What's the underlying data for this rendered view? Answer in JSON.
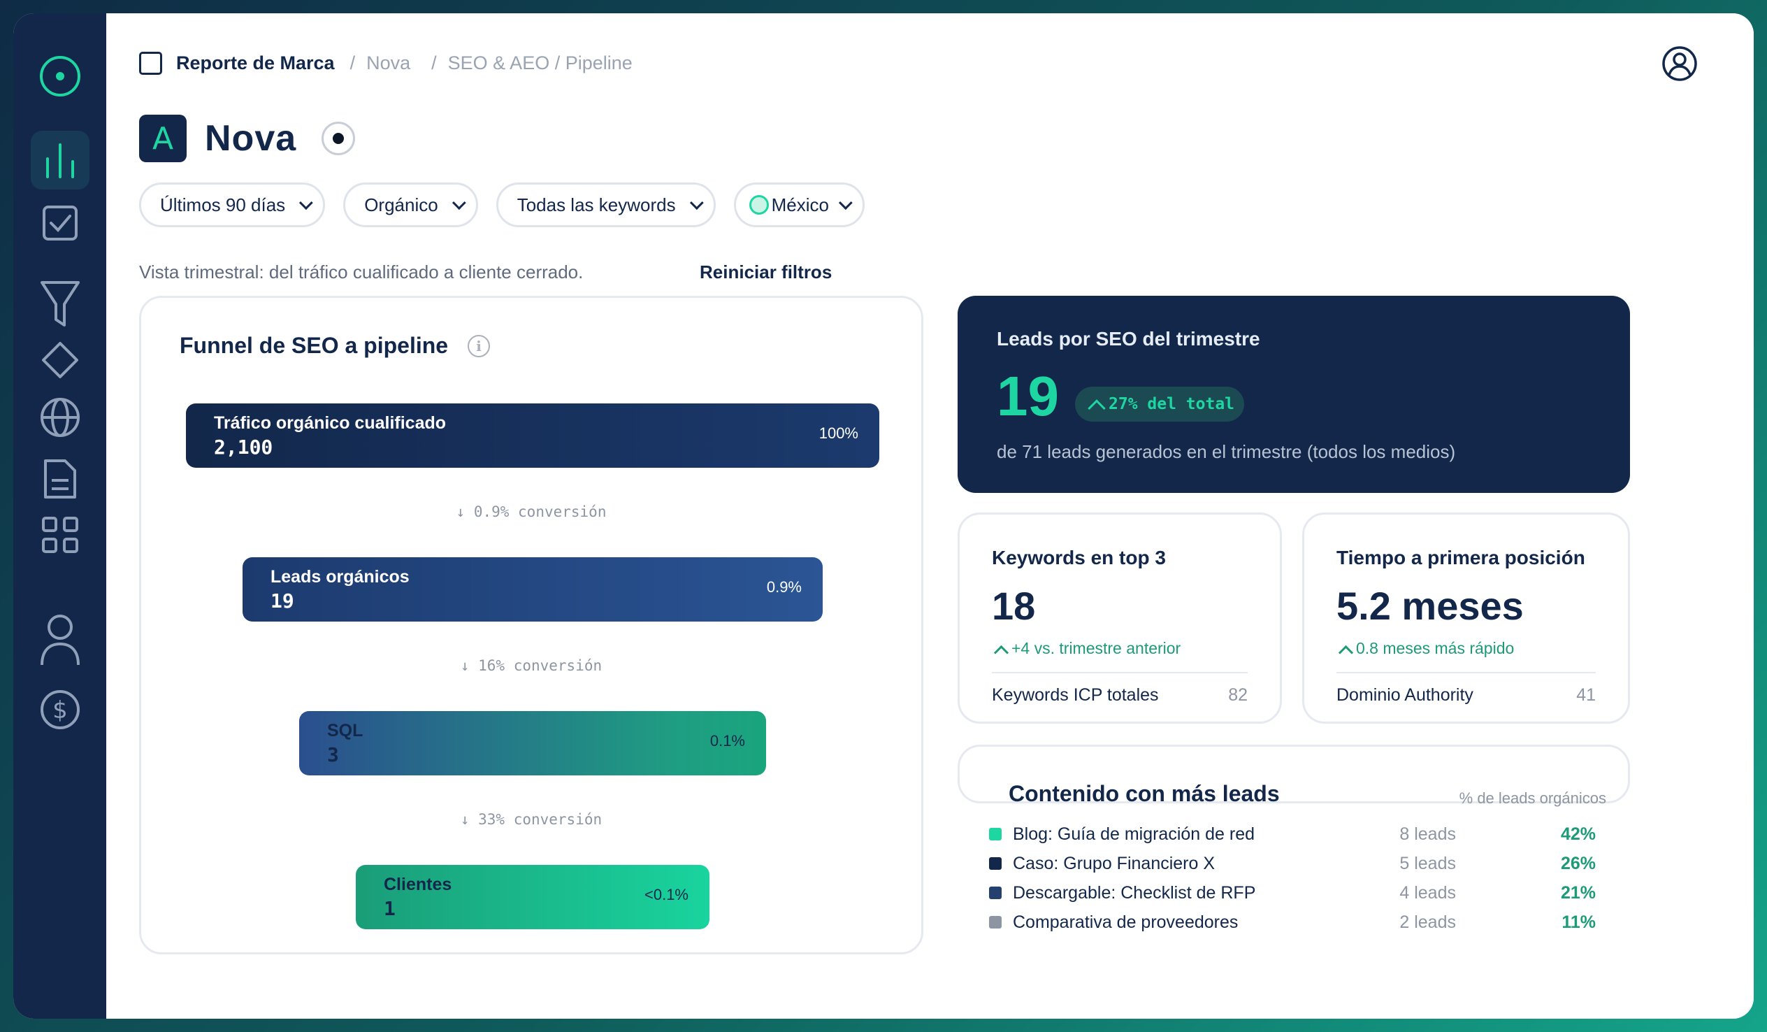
{
  "breadcrumb": {
    "root": "Reporte de Marca",
    "brand": "Nova",
    "section": "SEO & AEO / Pipeline"
  },
  "page": {
    "title": "Nova",
    "avatar_letter": "A"
  },
  "filters": [
    {
      "label": "Últimos 90 días"
    },
    {
      "label": "Orgánico"
    },
    {
      "label": "Todas las keywords"
    },
    {
      "label": "México"
    }
  ],
  "subtitle": "Vista trimestral: del tráfico cualificado a cliente cerrado.",
  "reset_label": "Reiniciar filtros",
  "funnel": {
    "title": "Funnel de SEO a pipeline",
    "stages": [
      {
        "label": "Tráfico orgánico cualificado",
        "value": "2,100",
        "pct": "100%"
      },
      {
        "label": "Leads orgánicos",
        "value": "19",
        "pct": "0.9%"
      },
      {
        "label": "SQL",
        "value": "3",
        "pct": "0.1%"
      },
      {
        "label": "Clientes",
        "value": "1",
        "pct": "<0.1%"
      }
    ],
    "conversions": [
      "↓ 0.9% conversión",
      "↓ 16% conversión",
      "↓ 33% conversión"
    ]
  },
  "leads_card": {
    "title": "Leads por SEO del trimestre",
    "value": "19",
    "badge": "27% del total",
    "sub": "de 71 leads generados en el trimestre (todos los medios)"
  },
  "kpis": [
    {
      "title": "Keywords en top 3",
      "value": "18",
      "delta": "+4 vs. trimestre anterior",
      "foot_label": "Keywords ICP totales",
      "foot_value": "82"
    },
    {
      "title": "Tiempo a primera posición",
      "value": "5.2 meses",
      "delta": "0.8 meses más rápido",
      "foot_label": "Dominio Authority",
      "foot_value": "41"
    }
  ],
  "content": {
    "title": "Contenido con más leads",
    "header": "% de leads orgánicos",
    "rows": [
      {
        "name": "Blog: Guía de migración de red",
        "leads": "8 leads",
        "pct": "42%",
        "color": "#1ed6a2"
      },
      {
        "name": "Caso: Grupo Financiero X",
        "leads": "5 leads",
        "pct": "26%",
        "color": "#12274a"
      },
      {
        "name": "Descargable: Checklist de RFP",
        "leads": "4 leads",
        "pct": "21%",
        "color": "#24406e"
      },
      {
        "name": "Comparativa de proveedores",
        "leads": "2 leads",
        "pct": "11%",
        "color": "#8d95a3"
      }
    ]
  },
  "colors": {
    "navy": "#12274a",
    "accent": "#1ed6a2",
    "accent_dark": "#1d9a78"
  },
  "sidebar_icons": [
    "target-icon",
    "bar-chart-icon",
    "checkbox-icon",
    "filter-icon",
    "diamond-icon",
    "globe-icon",
    "document-icon",
    "grid-icon",
    "user-icon",
    "dollar-icon"
  ]
}
